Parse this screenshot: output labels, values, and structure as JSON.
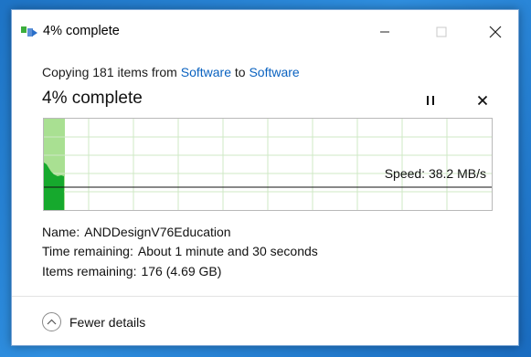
{
  "window": {
    "title": "4% complete",
    "icon": "file-copy-icon"
  },
  "progress": {
    "copy_prefix": "Copying 181 items from ",
    "source": "Software",
    "connector": " to ",
    "destination": "Software",
    "percent_label": "4% complete",
    "percent_value": 0.04,
    "speed_label": "Speed: 38.2 MB/s"
  },
  "details": {
    "name_label": "Name:",
    "name_value": "ANDDesignV76Education",
    "time_label": "Time remaining:",
    "time_value": "About 1 minute and 30 seconds",
    "items_label": "Items remaining:",
    "items_value": "176 (4.69 GB)"
  },
  "footer": {
    "fewer_details_label": "Fewer details"
  },
  "colors": {
    "progress_fill": "#a9e092",
    "graph_fill": "#16a92d",
    "link": "#0a62c0"
  }
}
